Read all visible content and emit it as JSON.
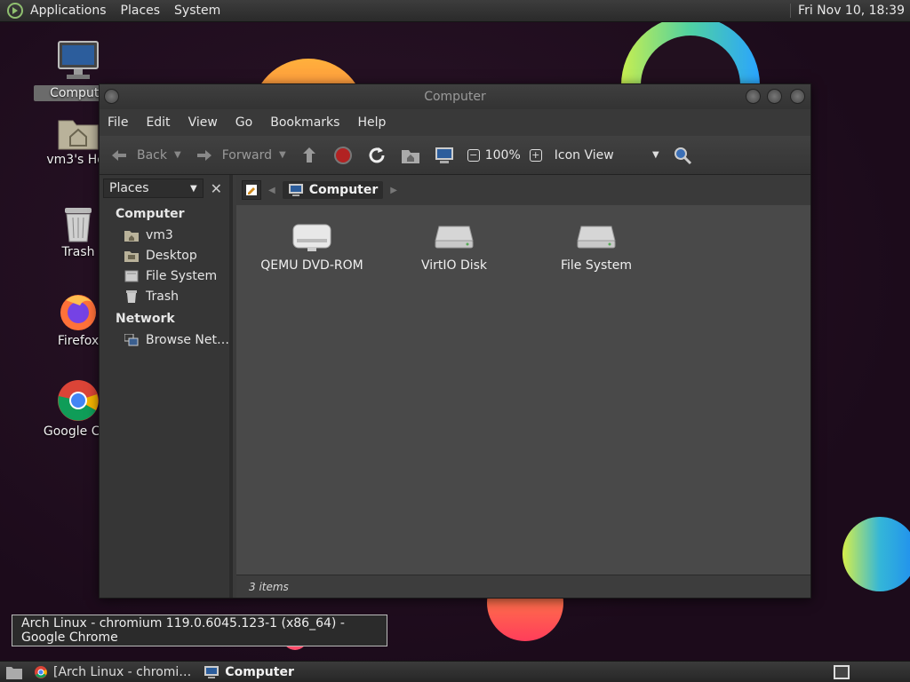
{
  "top_panel": {
    "menus": [
      "Applications",
      "Places",
      "System"
    ],
    "clock": "Fri Nov 10, 18:39"
  },
  "desktop_icons": {
    "computer": "Compute",
    "home": "vm3's Hor",
    "trash": "Trash",
    "firefox": "Firefox",
    "chrome": "Google Chr"
  },
  "window": {
    "title": "Computer",
    "menus": [
      "File",
      "Edit",
      "View",
      "Go",
      "Bookmarks",
      "Help"
    ],
    "toolbar": {
      "back": "Back",
      "forward": "Forward",
      "zoom": "100%",
      "view_mode": "Icon View"
    },
    "sidebar": {
      "selector": "Places",
      "groups": [
        {
          "label": "Computer",
          "items": [
            "vm3",
            "Desktop",
            "File System",
            "Trash"
          ]
        },
        {
          "label": "Network",
          "items": [
            "Browse Net…"
          ]
        }
      ]
    },
    "location": {
      "crumb": "Computer"
    },
    "files": [
      "QEMU DVD-ROM",
      "VirtIO Disk",
      "File System"
    ],
    "status": "3 items"
  },
  "tooltip": "Arch Linux - chromium 119.0.6045.123-1 (x86_64) - Google Chrome",
  "taskbar": {
    "chrome_task": "[Arch Linux - chromi…",
    "computer_task": "Computer"
  },
  "colors": {
    "accent_orange": "#ff9a3e",
    "panel_bg": "#2a2a2a",
    "window_bg": "#494949"
  }
}
